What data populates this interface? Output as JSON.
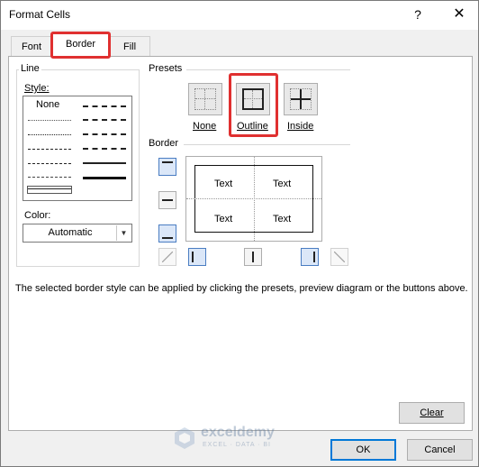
{
  "window": {
    "title": "Format Cells",
    "help_label": "?",
    "close_label": "✕"
  },
  "tabs": [
    {
      "label": "Font",
      "active": false
    },
    {
      "label": "Border",
      "active": true
    },
    {
      "label": "Fill",
      "active": false
    }
  ],
  "line": {
    "group_label": "Line",
    "style_label": "Style:",
    "none_label": "None",
    "color_label": "Color:",
    "color_value": "Automatic"
  },
  "presets": {
    "group_label": "Presets",
    "items": [
      {
        "label": "None",
        "icon": "preset-none-icon"
      },
      {
        "label": "Outline",
        "icon": "preset-outline-icon"
      },
      {
        "label": "Inside",
        "icon": "preset-inside-icon"
      }
    ]
  },
  "border": {
    "group_label": "Border",
    "preview_texts": [
      "Text",
      "Text",
      "Text",
      "Text"
    ]
  },
  "description": "The selected border style can be applied by clicking the presets, preview diagram or the buttons above.",
  "buttons": {
    "clear": "Clear",
    "ok": "OK",
    "cancel": "Cancel"
  },
  "watermark": {
    "name": "exceldemy",
    "tagline": "EXCEL · DATA · BI"
  },
  "colors": {
    "highlight": "#e03030",
    "accent": "#0078d7",
    "selected_border_button": "#dbe7f8"
  }
}
